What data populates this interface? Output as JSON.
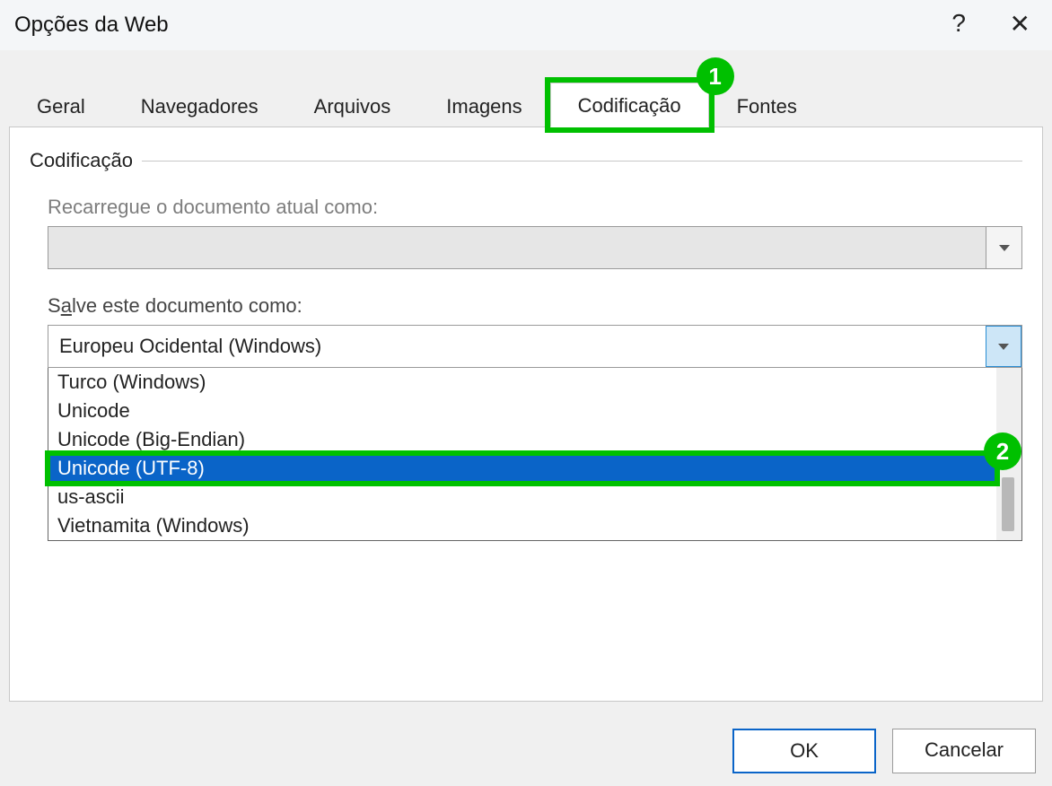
{
  "window": {
    "title": "Opções da Web",
    "help_tooltip": "?",
    "close_tooltip": "✕"
  },
  "tabs": [
    {
      "label": "Geral"
    },
    {
      "label": "Navegadores"
    },
    {
      "label": "Arquivos"
    },
    {
      "label": "Imagens"
    },
    {
      "label": "Codificação",
      "active": true
    },
    {
      "label": "Fontes"
    }
  ],
  "group": {
    "title": "Codificação"
  },
  "reload": {
    "label": "Recarregue o documento atual como:",
    "value": ""
  },
  "save": {
    "label_prefix": "S",
    "label_underlined": "a",
    "label_suffix": "lve este documento como:",
    "value": "Europeu Ocidental (Windows)",
    "options": [
      "Turco (Windows)",
      "Unicode",
      "Unicode (Big-Endian)",
      "Unicode (UTF-8)",
      "us-ascii",
      "Vietnamita (Windows)"
    ],
    "selected_option": "Unicode (UTF-8)"
  },
  "buttons": {
    "ok": "OK",
    "cancel": "Cancelar"
  },
  "annotations": {
    "badge1": "1",
    "badge2": "2"
  }
}
